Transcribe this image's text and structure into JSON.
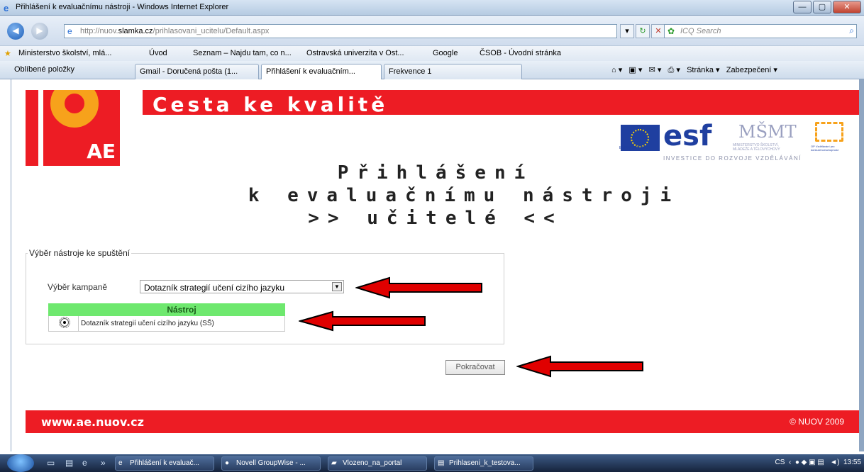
{
  "window": {
    "title": "Přihlášení k evaluačnímu nástroji - Windows Internet Explorer",
    "controls": {
      "minimize": "—",
      "maximize": "▢",
      "close": "✕"
    }
  },
  "address_bar": {
    "url_prefix": "http://nuov.",
    "url_domain": "slamka.cz",
    "url_path": "/prihlasovani_ucitelu/Default.aspx",
    "search_placeholder": "ICQ Search"
  },
  "favorites_bar": [
    "Ministerstvo školství, mlá...",
    "Úvod",
    "Seznam – Najdu tam, co n...",
    "Ostravská univerzita v Ost...",
    "Google",
    "ČSOB - Úvodní stránka"
  ],
  "tab_bar": {
    "favorites_label": "Oblíbené položky",
    "tabs": [
      "Gmail - Doručená pošta (1...",
      "Přihlášení k evaluačním...",
      "Frekvence 1"
    ],
    "commands": [
      "Stránka ▾",
      "Zabezpečení ▾"
    ]
  },
  "page": {
    "banner_title": "Cesta ke kvalitě",
    "logo_text": "AE",
    "eu_caption": "EVROPSKÁ UNIE",
    "esf_logo": "esf",
    "msmt_logo": "MŠMT",
    "msmt_caption": "MINISTERSTVO ŠKOLSTVÍ, MLÁDEŽE A TĚLOVÝCHOVY",
    "op_caption": "OP Vzdělávání pro konkurenceschopnost",
    "invest_caption": "INVESTICE DO ROZVOJE VZDĚLÁVÁNÍ",
    "heading_line1": "Přihlášení",
    "heading_line2": "k evaluačnímu nástroji",
    "heading_line3": ">> učitelé <<",
    "fieldset_legend": "Výběr nástroje ke spuštění",
    "campaign_label": "Výběr kampaně",
    "campaign_selected": "Dotazník strategií učení cizího jazyku",
    "grid_header": "Nástroj",
    "grid_rows": [
      {
        "label": "Dotazník strategií učení cizího jazyku (SŠ)",
        "selected": true
      }
    ],
    "continue_button": "Pokračovat",
    "footer_url": "www.ae.nuov.cz",
    "footer_copyright": "© NUOV 2009",
    "accent_color": "#ed1c24",
    "grid_header_color": "#6ee86e"
  },
  "taskbar": {
    "items": [
      "Přihlášení k evaluač...",
      "Novell GroupWise - ...",
      "Vlozeno_na_portal",
      "Prihlaseni_k_testova..."
    ],
    "tray_lang": "CS",
    "clock": "13:55"
  }
}
